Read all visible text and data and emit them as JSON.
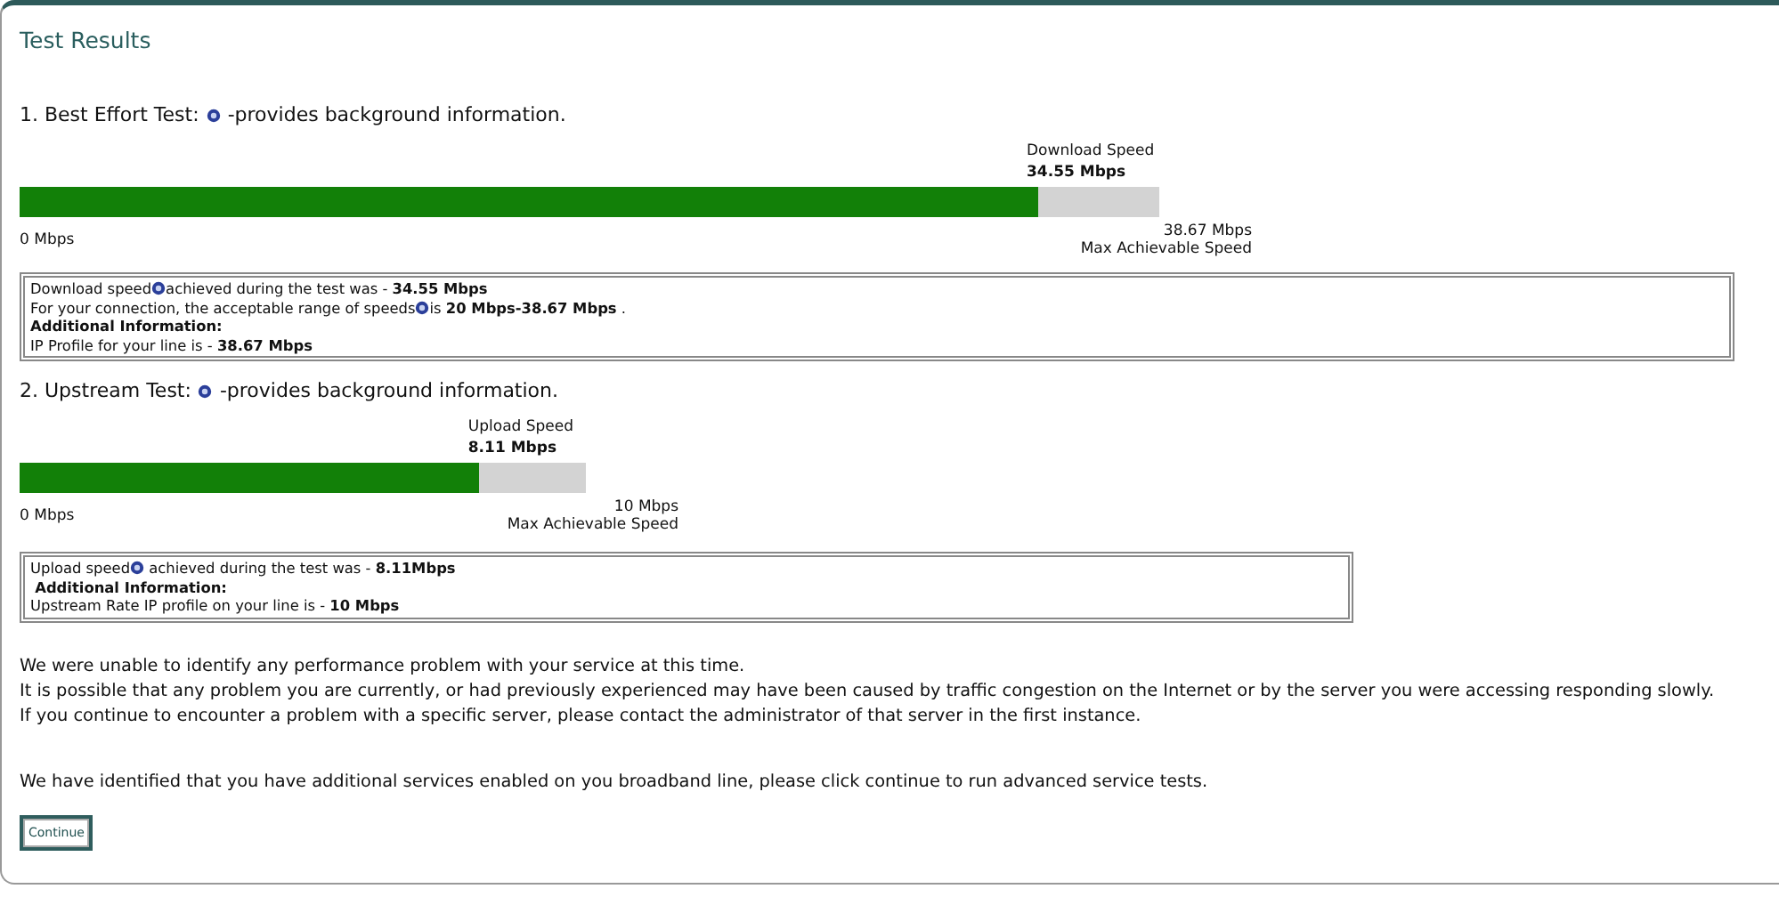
{
  "title": "Test Results",
  "tests": [
    {
      "heading": "1. Best Effort Test:",
      "heading_tail": "-provides background information.",
      "speed_label": "Download Speed",
      "speed_value": "34.55 Mbps",
      "level": 0.893,
      "min_label": "0 Mbps",
      "max_value": "38.67 Mbps",
      "max_label": "Max Achievable Speed",
      "info": [
        [
          {
            "text": "Download speed"
          },
          {
            "kind": "icon"
          },
          {
            "text": "achieved during the test was - **34.55 Mbps**"
          }
        ],
        [
          {
            "text": "For your connection, the acceptable range of speeds"
          },
          {
            "kind": "icon"
          },
          {
            "text": "is **20 Mbps-38.67 Mbps** ."
          }
        ],
        [
          {
            "text": "**Additional Information:**"
          }
        ],
        [
          {
            "text": "IP Profile for your line is - **38.67 Mbps**"
          }
        ]
      ]
    },
    {
      "heading": "2. Upstream Test:",
      "heading_tail": "-provides background information.",
      "speed_label": "Upload Speed",
      "speed_value": "8.11 Mbps",
      "level": 0.811,
      "min_label": "0 Mbps",
      "max_value": "10 Mbps",
      "max_label": "Max Achievable Speed",
      "info": [
        [
          {
            "text": "Upload speed"
          },
          {
            "kind": "icon"
          },
          {
            "text": " achieved during the test was - **8.11Mbps**"
          }
        ],
        [
          {
            "text": " **Additional Information:**"
          }
        ],
        [
          {
            "text": "Upstream Rate IP profile on your line is - **10 Mbps**"
          }
        ]
      ]
    }
  ],
  "messages": [
    "We were unable to identify any performance problem with your service at this time.",
    "It is possible that any problem you are currently, or had previously experienced may have been caused by traffic congestion on the Internet or by the server you were accessing responding slowly.",
    "If you continue to encounter a problem with a specific server, please contact the administrator of that server in the first instance."
  ],
  "advanced_message": "We have identified that you have additional services enabled on you broadband line, please click continue to run advanced service tests.",
  "button": "Continue"
}
